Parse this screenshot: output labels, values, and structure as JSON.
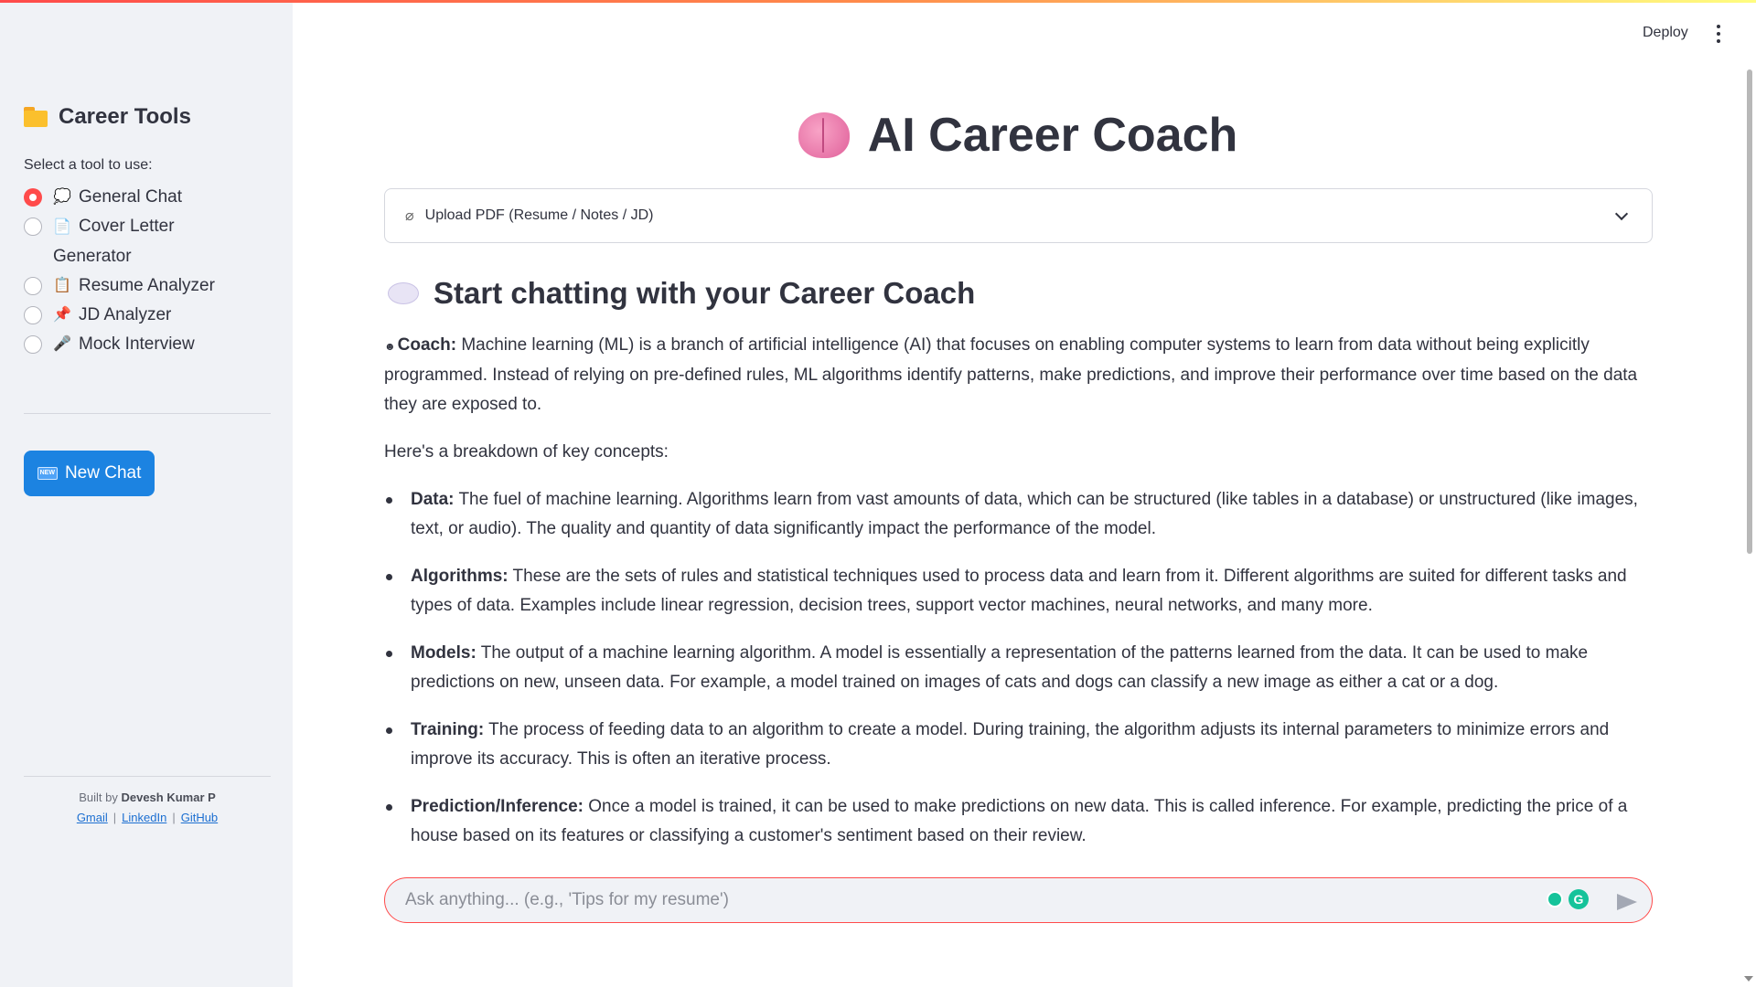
{
  "sidebar": {
    "title": "Career Tools",
    "select_label": "Select a tool to use:",
    "tools": [
      {
        "emoji": "💭",
        "label": "General Chat",
        "selected": true
      },
      {
        "emoji": "📄",
        "label": "Cover Letter Generator",
        "selected": false
      },
      {
        "emoji": "📋",
        "label": "Resume Analyzer",
        "selected": false
      },
      {
        "emoji": "📌",
        "label": "JD Analyzer",
        "selected": false
      },
      {
        "emoji": "🎤",
        "label": "Mock Interview",
        "selected": false
      }
    ],
    "new_chat_badge": "NEW",
    "new_chat_label": "New Chat",
    "footer": {
      "built_by": "Built by",
      "author": "Devesh Kumar P",
      "links": [
        "Gmail",
        "LinkedIn",
        "GitHub"
      ],
      "separator": "|"
    }
  },
  "header": {
    "deploy_label": "Deploy"
  },
  "main": {
    "title": "AI Career Coach",
    "uploader_label": "Upload PDF (Resume / Notes / JD)",
    "chat_heading": "Start chatting with your Career Coach",
    "message": {
      "speaker": "Coach:",
      "intro": "Machine learning (ML) is a branch of artificial intelligence (AI) that focuses on enabling computer systems to learn from data without being explicitly programmed. Instead of relying on pre-defined rules, ML algorithms identify patterns, make predictions, and improve their performance over time based on the data they are exposed to.",
      "breakdown": "Here's a breakdown of key concepts:",
      "concepts": [
        {
          "term": "Data:",
          "text": "The fuel of machine learning. Algorithms learn from vast amounts of data, which can be structured (like tables in a database) or unstructured (like images, text, or audio). The quality and quantity of data significantly impact the performance of the model."
        },
        {
          "term": "Algorithms:",
          "text": "These are the sets of rules and statistical techniques used to process data and learn from it. Different algorithms are suited for different tasks and types of data. Examples include linear regression, decision trees, support vector machines, neural networks, and many more."
        },
        {
          "term": "Models:",
          "text": "The output of a machine learning algorithm. A model is essentially a representation of the patterns learned from the data. It can be used to make predictions on new, unseen data. For example, a model trained on images of cats and dogs can classify a new image as either a cat or a dog."
        },
        {
          "term": "Training:",
          "text": "The process of feeding data to an algorithm to create a model. During training, the algorithm adjusts its internal parameters to minimize errors and improve its accuracy. This is often an iterative process."
        },
        {
          "term": "Prediction/Inference:",
          "text": "Once a model is trained, it can be used to make predictions on new data. This is called inference. For example, predicting the price of a house based on its features or classifying a customer's sentiment based on their review."
        }
      ]
    },
    "chat_input_placeholder": "Ask anything... (e.g., 'Tips for my resume')"
  },
  "colors": {
    "accent": "#ff4b4b",
    "button_blue": "#1c83e1",
    "sidebar_bg": "#f0f2f6",
    "text": "#31333f"
  }
}
